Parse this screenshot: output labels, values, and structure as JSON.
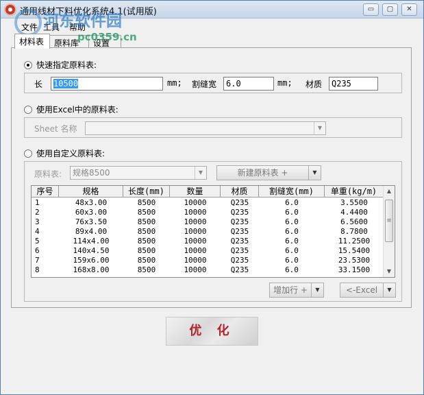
{
  "window": {
    "title": "通用线材下料优化系统4.1(试用版)",
    "buttons": {
      "minimize": "▭",
      "restore": "▢",
      "close": "✕"
    }
  },
  "menu": [
    "文件",
    "工具",
    "帮助"
  ],
  "watermark": {
    "name": "河东软件园",
    "url": "pc0359.cn"
  },
  "tabs": [
    "材料表",
    "原料库",
    "设置"
  ],
  "quick": {
    "radio_label": "快速指定原料表:",
    "length_label": "长",
    "length_value": "10500",
    "unit1": "mm;",
    "kerf_label": "割缝宽",
    "kerf_value": "6.0",
    "unit2": "mm;",
    "material_label": "材质",
    "material_value": "Q235"
  },
  "excel": {
    "radio_label": "使用Excel中的原料表:",
    "sheet_label": "Sheet 名称",
    "sheet_value": ""
  },
  "custom": {
    "radio_label": "使用自定义原料表:",
    "stock_label": "原料表:",
    "stock_value": "规格8500",
    "new_button": "新建原料表 +"
  },
  "table": {
    "columns": [
      "序号",
      "规格",
      "长度(mm)",
      "数量",
      "材质",
      "割缝宽(mm)",
      "单重(kg/m)"
    ],
    "rows": [
      [
        "1",
        "48x3.00",
        "8500",
        "10000",
        "Q235",
        "6.0",
        "3.5500"
      ],
      [
        "2",
        "60x3.00",
        "8500",
        "10000",
        "Q235",
        "6.0",
        "4.4400"
      ],
      [
        "3",
        "76x3.50",
        "8500",
        "10000",
        "Q235",
        "6.0",
        "6.5600"
      ],
      [
        "4",
        "89x4.00",
        "8500",
        "10000",
        "Q235",
        "6.0",
        "8.7800"
      ],
      [
        "5",
        "114x4.00",
        "8500",
        "10000",
        "Q235",
        "6.0",
        "11.2500"
      ],
      [
        "6",
        "140x4.50",
        "8500",
        "10000",
        "Q235",
        "6.0",
        "15.5400"
      ],
      [
        "7",
        "159x6.00",
        "8500",
        "10000",
        "Q235",
        "6.0",
        "23.5300"
      ],
      [
        "8",
        "168x8.00",
        "8500",
        "10000",
        "Q235",
        "6.0",
        "33.1500"
      ]
    ]
  },
  "buttons": {
    "add_row": "增加行 +",
    "excel": "<-Excel",
    "optimize": "优 化"
  },
  "icons": {
    "dropdown": "▼",
    "scroll_up": "▲",
    "scroll_down": "▼",
    "grip": "≡"
  }
}
